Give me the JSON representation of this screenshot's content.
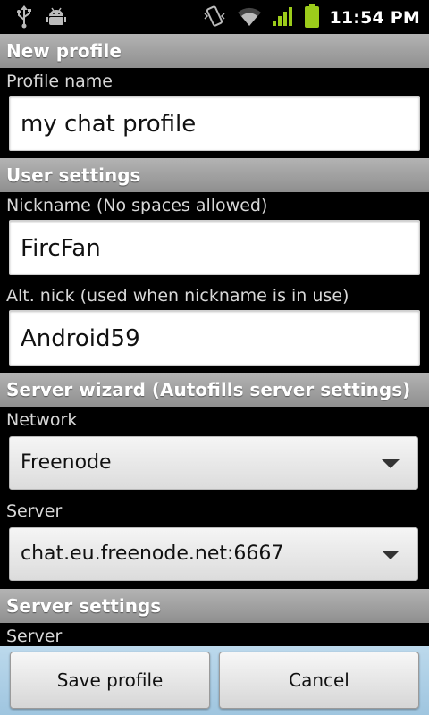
{
  "status_bar": {
    "time": "11:54 PM",
    "icons": [
      "usb-icon",
      "android-debug-icon",
      "vibrate-icon",
      "wifi-icon",
      "signal-icon",
      "battery-icon"
    ],
    "battery_color": "#9ccc1b",
    "signal_color": "#9ccc1b"
  },
  "sections": {
    "new_profile": "New profile",
    "user_settings": "User settings",
    "server_wizard": "Server wizard (Autofills server settings)",
    "server_settings": "Server settings"
  },
  "fields": {
    "profile_name": {
      "label": "Profile name",
      "value": "my chat profile"
    },
    "nickname": {
      "label": "Nickname (No spaces allowed)",
      "value": "FircFan"
    },
    "alt_nick": {
      "label": "Alt. nick (used when nickname is in use)",
      "value": "Android59"
    },
    "network": {
      "label": "Network",
      "value": "Freenode"
    },
    "server": {
      "label": "Server",
      "value": "chat.eu.freenode.net:6667"
    },
    "server_settings_server": {
      "label": "Server"
    }
  },
  "buttons": {
    "save": "Save profile",
    "cancel": "Cancel"
  }
}
